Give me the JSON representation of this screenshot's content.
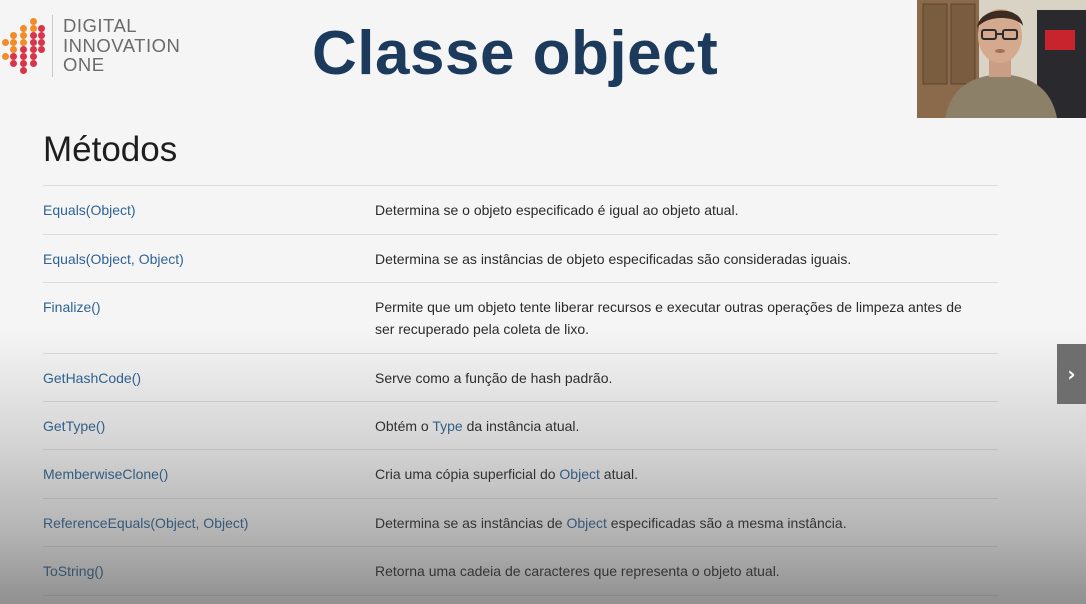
{
  "logo": {
    "line1": "DIGITAL",
    "line2": "INNOVATION",
    "line3": "ONE"
  },
  "slide_title": "Classe object",
  "section_title": "Métodos",
  "methods": [
    {
      "name": "Equals(Object)",
      "desc_before": "Determina se o objeto especificado é igual ao objeto atual.",
      "link": "",
      "desc_after": ""
    },
    {
      "name": "Equals(Object, Object)",
      "desc_before": "Determina se as instâncias de objeto especificadas são consideradas iguais.",
      "link": "",
      "desc_after": ""
    },
    {
      "name": "Finalize()",
      "desc_before": "Permite que um objeto tente liberar recursos e executar outras operações de limpeza antes de ser recuperado pela coleta de lixo.",
      "link": "",
      "desc_after": ""
    },
    {
      "name": "GetHashCode()",
      "desc_before": "Serve como a função de hash padrão.",
      "link": "",
      "desc_after": ""
    },
    {
      "name": "GetType()",
      "desc_before": "Obtém o ",
      "link": "Type",
      "desc_after": " da instância atual."
    },
    {
      "name": "MemberwiseClone()",
      "desc_before": "Cria uma cópia superficial do ",
      "link": "Object",
      "desc_after": " atual."
    },
    {
      "name": "ReferenceEquals(Object, Object)",
      "desc_before": "Determina se as instâncias de ",
      "link": "Object",
      "desc_after": " especificadas são a mesma instância."
    },
    {
      "name": "ToString()",
      "desc_before": "Retorna uma cadeia de caracteres que representa o objeto atual.",
      "link": "",
      "desc_after": ""
    }
  ],
  "nav": {
    "next_icon": "chevron-right-icon"
  },
  "colors": {
    "title": "#1c3a5c",
    "link": "#2f6394",
    "logo_orange": "#f28c28",
    "logo_red": "#d8344a"
  }
}
